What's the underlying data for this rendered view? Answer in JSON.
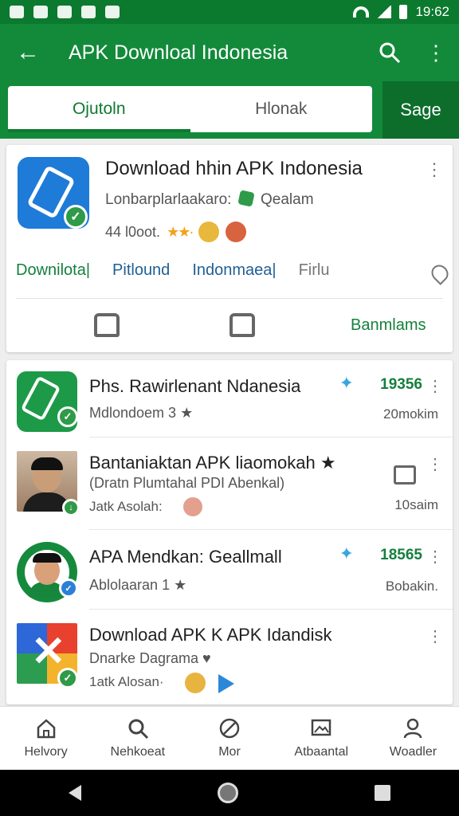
{
  "status_bar": {
    "time": "19:62"
  },
  "app_bar": {
    "title": "APK Downloal Indonesia"
  },
  "tabs": [
    {
      "label": "Ojutoln",
      "active": true
    },
    {
      "label": "Hlonak",
      "active": false
    }
  ],
  "tab_side_label": "Sage",
  "featured": {
    "title": "Download hhin APK Indonesia",
    "developer": "Lonbarplarlaakaro:",
    "developer_extra": "Qealam",
    "meta": "44 l0oot.",
    "links": [
      "Downilota|",
      "Pitlound",
      "Indonmaea|",
      "Firlu"
    ],
    "action_text": "Banmlams"
  },
  "list_items": [
    {
      "title": "Phs. Rawirlenant Ndanesia",
      "subtitle": "Mdlondoem 3 ★",
      "metric": "19356",
      "metric_sub": "20mokim"
    },
    {
      "title": "Bantaniaktan APK liaomokah ★",
      "subtitle": "(Dratn Plumtahal PDI Abenkal)",
      "subtitle2": "Jatk Asolah:",
      "metric_sub": "10saim"
    },
    {
      "title": "APA Mendkan: Geallmall",
      "subtitle": "Ablolaaran 1 ★",
      "metric": "18565",
      "metric_sub": "Bobakin."
    },
    {
      "title": "Download APK K APK Idandisk",
      "subtitle": "Dnarke Dagrama ♥",
      "subtitle2": "1atk Alosan·"
    }
  ],
  "bottom_nav": [
    {
      "label": "Helvory",
      "icon": "home-icon"
    },
    {
      "label": "Nehkoeat",
      "icon": "search-icon"
    },
    {
      "label": "Mor",
      "icon": "blocked-icon"
    },
    {
      "label": "Atbaantal",
      "icon": "picture-icon"
    },
    {
      "label": "Woadler",
      "icon": "person-icon"
    }
  ],
  "colors": {
    "primary": "#128a3a",
    "primary_dark": "#0b7a2e",
    "accent_green": "#15803d",
    "link_blue": "#1f5f94",
    "star": "#f2a31a"
  }
}
